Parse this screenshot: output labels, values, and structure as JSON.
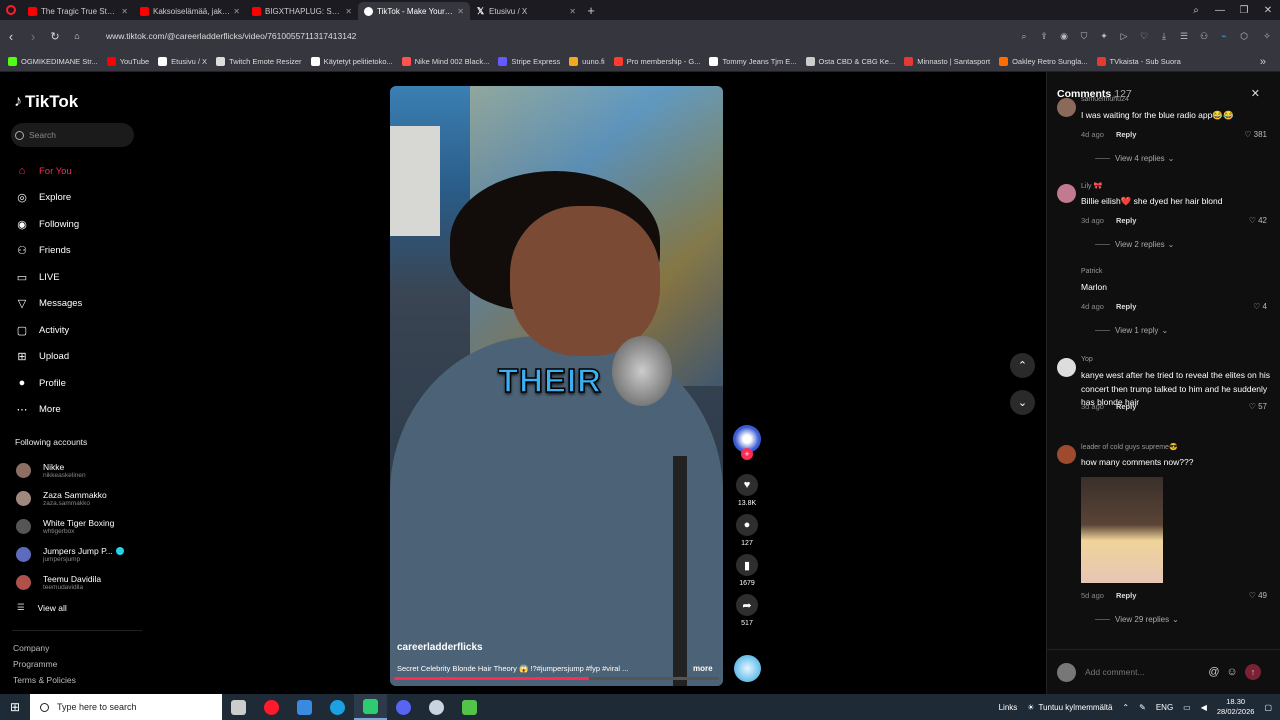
{
  "browser": {
    "tabs": [
      {
        "title": "The Tragic True Story of Ju",
        "icon": "youtube-icon",
        "active": false
      },
      {
        "title": "Kaksoiselämää, jakso 4 - L",
        "icon": "youtube-icon",
        "active": false
      },
      {
        "title": "BIGXTHAPLUG: Sundae C",
        "icon": "youtube-icon",
        "active": false
      },
      {
        "title": "TikTok - Make Your Da",
        "icon": "tiktok-icon",
        "active": true
      },
      {
        "title": "Etusivu / X",
        "icon": "x-icon",
        "active": false
      }
    ],
    "url": "www.tiktok.com/@careerladderflicks/video/7610055711317413142",
    "bookmarks": [
      {
        "label": "OGMIKEDIMANE Str...",
        "color": "#53fc18"
      },
      {
        "label": "YouTube",
        "color": "#ff0000"
      },
      {
        "label": "Etusivu / X",
        "color": "#ffffff"
      },
      {
        "label": "Twitch Emote Resizer",
        "color": "#dddddd"
      },
      {
        "label": "Käytetyt pelitietoko...",
        "color": "#ffffff"
      },
      {
        "label": "Nike Mind 002 Black...",
        "color": "#ff5252"
      },
      {
        "label": "Stripe Express",
        "color": "#635bff"
      },
      {
        "label": "uuno.fi",
        "color": "#f5a623"
      },
      {
        "label": "Pro membership - G...",
        "color": "#ff3b30"
      },
      {
        "label": "Tommy Jeans Tjm E...",
        "color": "#ffffff"
      },
      {
        "label": "Osta CBD & CBG Ke...",
        "color": "#cccccc"
      },
      {
        "label": "Minnasto | Santasport",
        "color": "#e53935"
      },
      {
        "label": "Oakley Retro Sungla...",
        "color": "#ff6d00"
      },
      {
        "label": "TVkaista - Sub Suora",
        "color": "#e53935"
      }
    ]
  },
  "tiktok": {
    "brand": "TikTok",
    "search_placeholder": "Search",
    "nav": [
      {
        "label": "For You",
        "icon": "home-icon",
        "selected": true
      },
      {
        "label": "Explore",
        "icon": "compass-icon",
        "selected": false
      },
      {
        "label": "Following",
        "icon": "following-icon",
        "selected": false
      },
      {
        "label": "Friends",
        "icon": "friends-icon",
        "selected": false
      },
      {
        "label": "LIVE",
        "icon": "live-icon",
        "selected": false
      },
      {
        "label": "Messages",
        "icon": "messages-icon",
        "selected": false
      },
      {
        "label": "Activity",
        "icon": "activity-icon",
        "selected": false
      },
      {
        "label": "Upload",
        "icon": "upload-icon",
        "selected": false
      },
      {
        "label": "Profile",
        "icon": "profile-icon",
        "selected": false
      },
      {
        "label": "More",
        "icon": "more-icon",
        "selected": false
      }
    ],
    "following_header": "Following accounts",
    "following_accounts": [
      {
        "name": "Nikke",
        "username": "nikkeaskelinen",
        "color": "#8d6e63",
        "verified": false
      },
      {
        "name": "Zaza Sammakko",
        "username": "zaza.sammakko",
        "color": "#a1887f",
        "verified": false
      },
      {
        "name": "White Tiger Boxing",
        "username": "whtigerbox",
        "color": "#555555",
        "verified": false
      },
      {
        "name": "Jumpers Jump P...",
        "username": "jumpersjump",
        "color": "#5c6bc0",
        "verified": true
      },
      {
        "name": "Teemu Davidila",
        "username": "teemudavidila",
        "color": "#b0504a",
        "verified": false
      }
    ],
    "view_all": "View all",
    "footer": [
      "Company",
      "Programme",
      "Terms & Policies"
    ]
  },
  "video": {
    "caption": "THEIR",
    "author": "careerladderflicks",
    "description": "Secret Celebrity Blonde Hair Theory 😱 !?#jumpersjump #fyp #viral ...",
    "more": "more",
    "progress": 0.6,
    "likes": "13.8K",
    "comments": "127",
    "saves": "1679",
    "shares": "517"
  },
  "comments_panel": {
    "title": "Comments",
    "count": "127",
    "comments": [
      {
        "user": "samuelmuhu24",
        "text": "I was waiting for the blue radio app😂😂",
        "age": "4d ago",
        "likes": "381",
        "replies": "View 4 replies",
        "avatar_color": "#8c6a5a"
      },
      {
        "user": "Lily 🎀",
        "text": "Billie eilish❤️ she dyed her hair blond",
        "age": "3d ago",
        "likes": "42",
        "replies": "View 2 replies",
        "avatar_color": "#c27a90"
      },
      {
        "user": "Patrick",
        "text": "Marlon",
        "age": "4d ago",
        "likes": "4",
        "replies": "View 1 reply",
        "avatar_color": ""
      },
      {
        "user": "Yop",
        "text": "kanye west after he tried to reveal the elites on his concert then trump talked to him and he suddenly has blonde hair",
        "age": "3d ago",
        "likes": "57",
        "replies": "",
        "avatar_color": "#dddddd"
      },
      {
        "user": "leader of cold guys supreme😎",
        "text": "how many comments now???",
        "age": "5d ago",
        "likes": "49",
        "replies": "View 29 replies",
        "avatar_color": "#9e4a2e"
      }
    ],
    "reply_label": "Reply",
    "add_placeholder": "Add comment..."
  },
  "taskbar": {
    "search_placeholder": "Type here to search",
    "apps": [
      {
        "icon": "task-view-icon",
        "color": "#cccccc"
      },
      {
        "icon": "opera-icon",
        "color": "#ff1b2d"
      },
      {
        "icon": "paint-icon",
        "color": "#3a8be0"
      },
      {
        "icon": "edge-icon",
        "color": "#1ba1e2"
      },
      {
        "icon": "app-green-icon",
        "color": "#2ecc71"
      },
      {
        "icon": "discord-icon",
        "color": "#5865f2"
      },
      {
        "icon": "steam-icon",
        "color": "#c7d5e0"
      },
      {
        "icon": "terminal-icon",
        "color": "#54c34a"
      }
    ],
    "links": "Links",
    "weather": "Tuntuu kylmemmältä",
    "lang": "ENG",
    "time": "18.30",
    "date": "28/02/2026"
  }
}
